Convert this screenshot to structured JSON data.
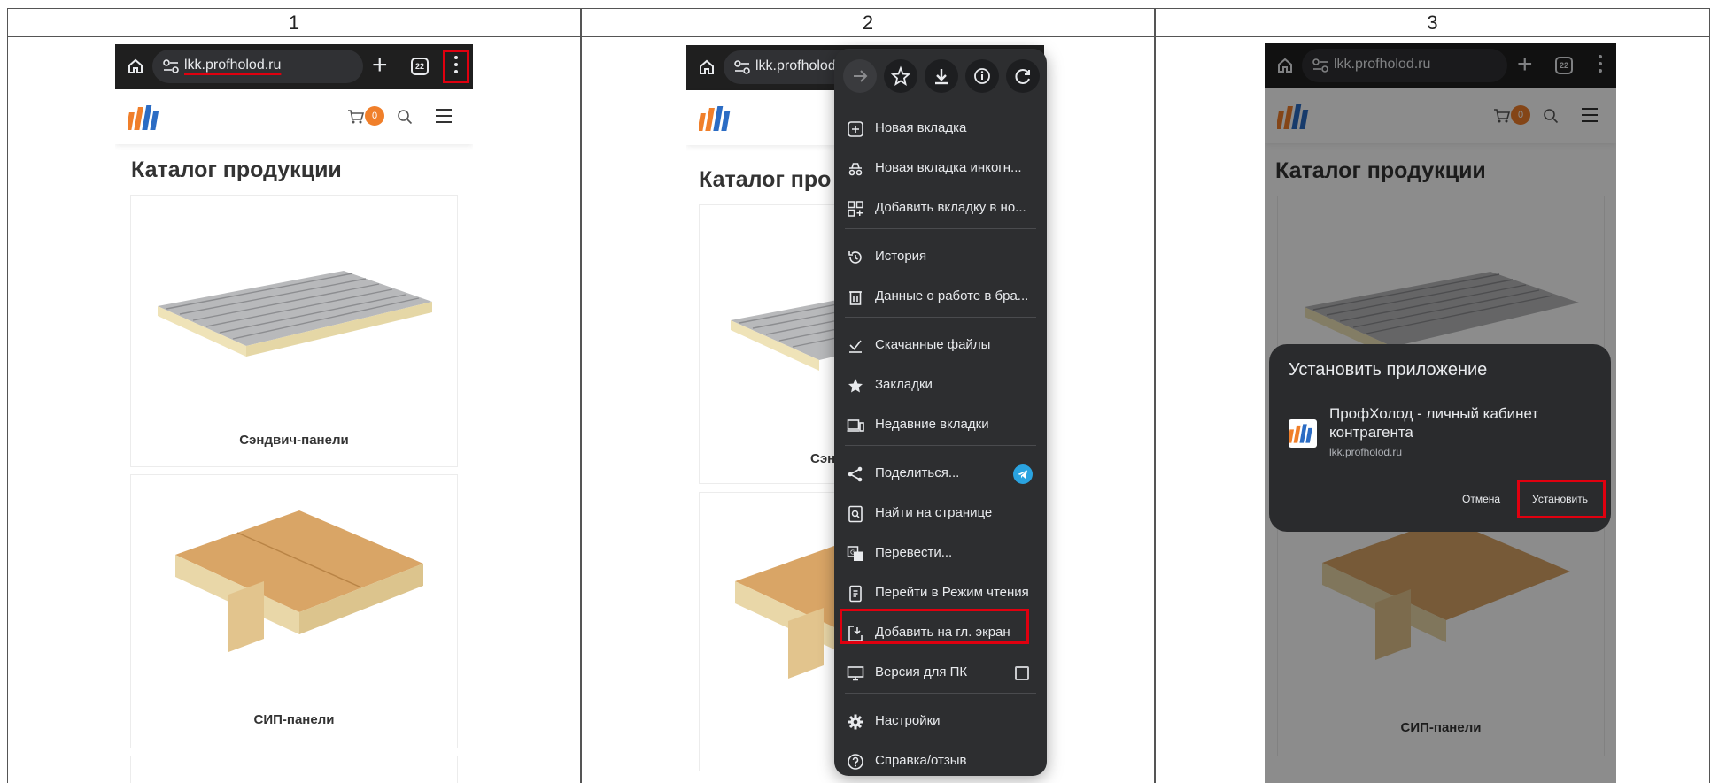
{
  "columns": [
    "1",
    "2",
    "3"
  ],
  "browser": {
    "url": "lkk.profholod.ru",
    "tab_count": "22"
  },
  "site": {
    "cart_count": "0",
    "page_title": "Каталог продукции",
    "page_title_partial": "Каталог про",
    "products": [
      {
        "name": "Сэндвич-панели"
      },
      {
        "name": "СИП-панели"
      }
    ],
    "partial_captions": [
      "Сэн",
      "С"
    ]
  },
  "menu": {
    "items": [
      {
        "label": "Новая вкладка",
        "icon": "new-tab-icon"
      },
      {
        "label": "Новая вкладка инкогн...",
        "icon": "incognito-icon"
      },
      {
        "label": "Добавить вкладку в но...",
        "icon": "tab-group-icon"
      },
      {
        "label": "История",
        "icon": "history-icon"
      },
      {
        "label": "Данные о работе в бра...",
        "icon": "trash-icon"
      },
      {
        "label": "Скачанные файлы",
        "icon": "downloads-icon"
      },
      {
        "label": "Закладки",
        "icon": "star-icon"
      },
      {
        "label": "Недавние вкладки",
        "icon": "devices-icon"
      },
      {
        "label": "Поделиться...",
        "icon": "share-icon"
      },
      {
        "label": "Найти на странице",
        "icon": "find-icon"
      },
      {
        "label": "Перевести...",
        "icon": "translate-icon"
      },
      {
        "label": "Перейти в Режим чтения",
        "icon": "reader-mode-icon"
      },
      {
        "label": "Добавить на гл. экран",
        "icon": "add-to-home-icon"
      },
      {
        "label": "Версия для ПК",
        "icon": "desktop-icon"
      },
      {
        "label": "Настройки",
        "icon": "settings-icon"
      },
      {
        "label": "Справка/отзыв",
        "icon": "help-icon"
      }
    ]
  },
  "dialog": {
    "title": "Установить приложение",
    "app_name": "ПрофХолод - личный кабинет контрагента",
    "app_url": "lkk.profholod.ru",
    "cancel": "Отмена",
    "install": "Установить"
  },
  "colors": {
    "highlight": "#e0000f",
    "badge": "#f07f2a",
    "browser_bar": "#1f1f1f",
    "menu_bg": "#2d2e30"
  }
}
